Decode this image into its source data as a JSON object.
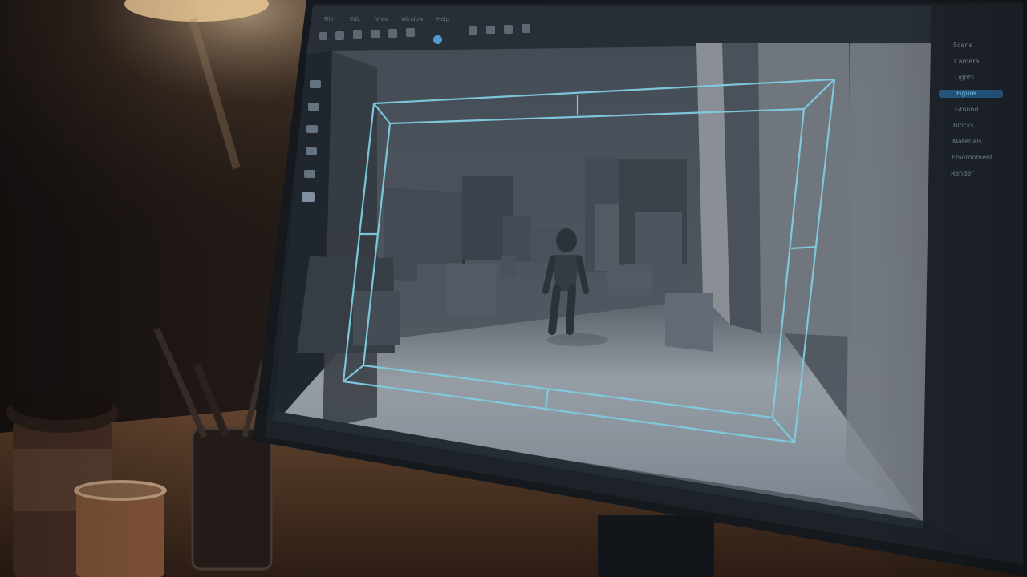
{
  "app": {
    "menu_items": [
      "File",
      "Edit",
      "View",
      "Window",
      "Help"
    ],
    "document_title": ""
  },
  "viewport": {
    "objects": [
      "camera-frustum-wireframe",
      "humanoid-figure",
      "box-buildings",
      "ground-plane"
    ]
  },
  "right_panel": {
    "items": [
      "Scene",
      "Camera",
      "Lights",
      "Figure",
      "Ground",
      "Blocks",
      "Materials",
      "Environment",
      "Render"
    ],
    "selected_index": 3
  },
  "colors": {
    "wireframe": "#8ee7ff",
    "ui_bg": "#232b33",
    "accent": "#5fb7ff"
  }
}
